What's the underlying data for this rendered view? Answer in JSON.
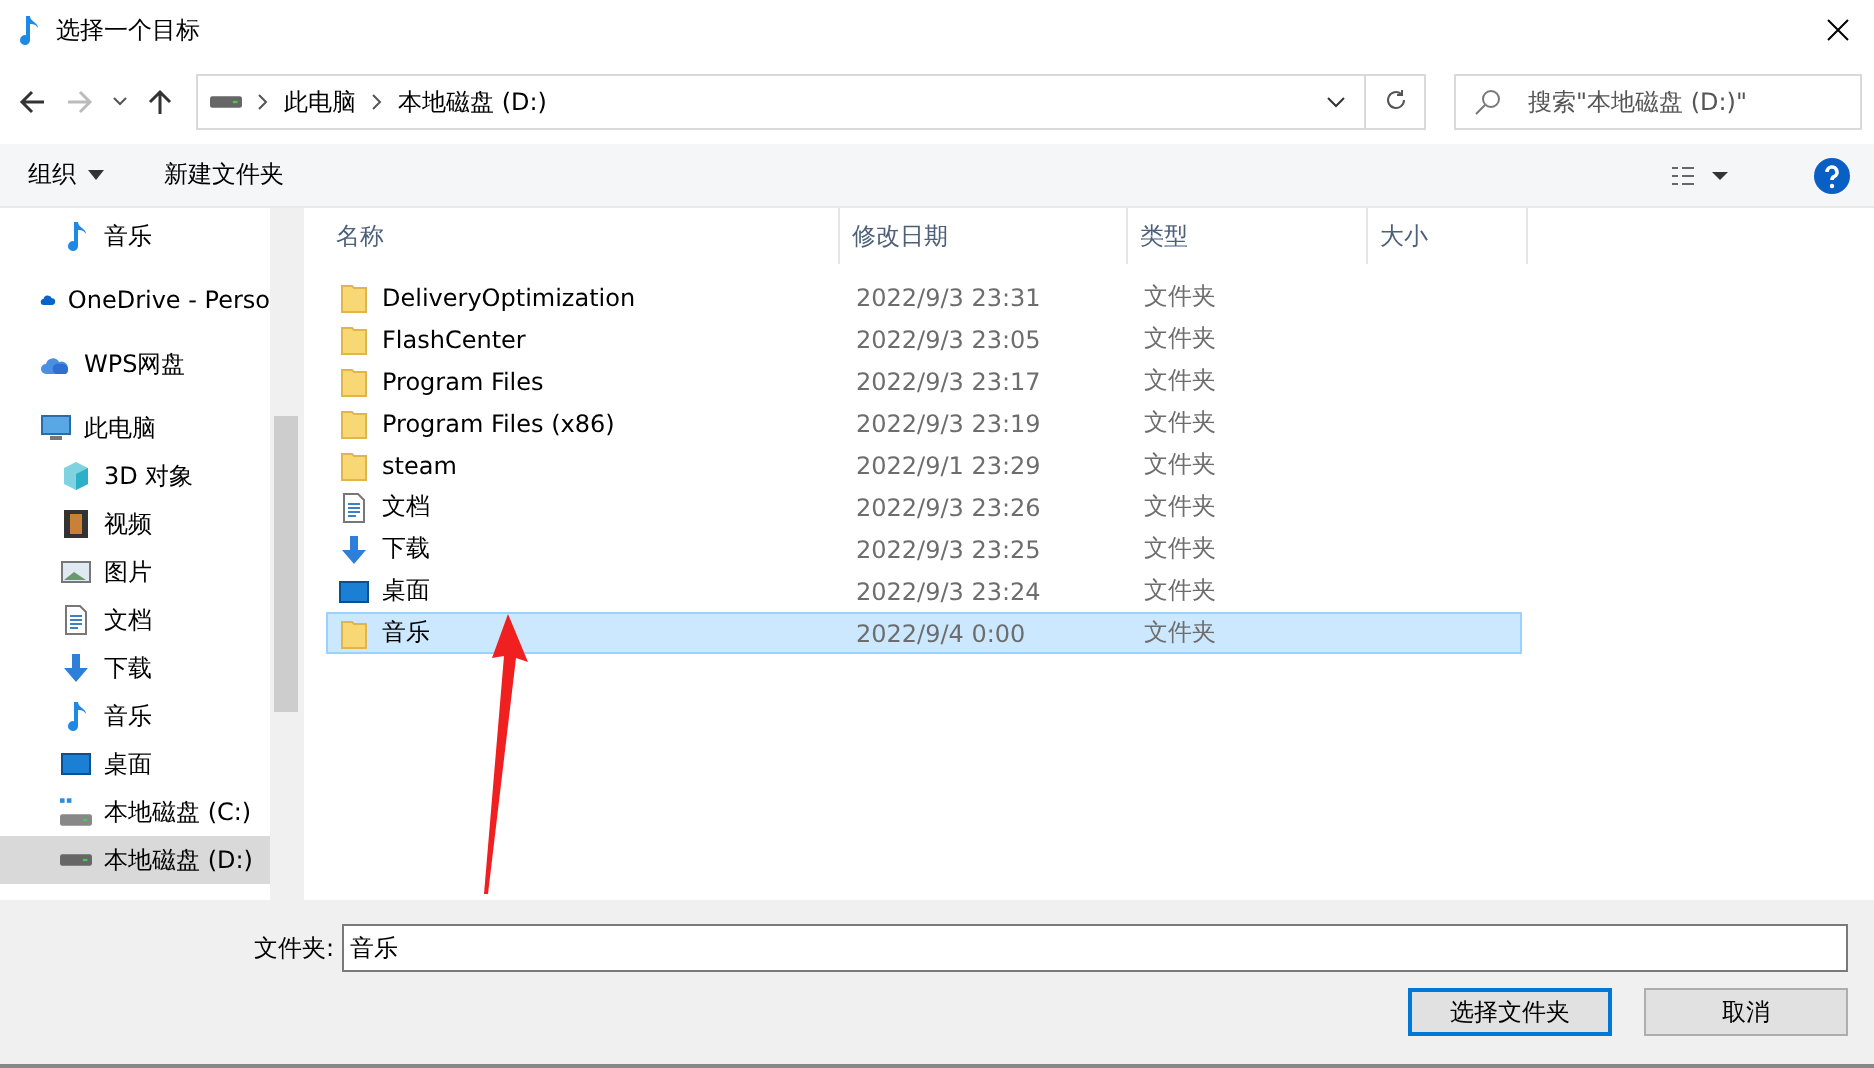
{
  "window": {
    "title": "选择一个目标"
  },
  "address": {
    "crumbs": [
      "此电脑",
      "本地磁盘 (D:)"
    ],
    "search_placeholder": "搜索\"本地磁盘 (D:)\""
  },
  "toolbar": {
    "organize": "组织",
    "new_folder": "新建文件夹"
  },
  "sidebar": {
    "quick_access_tail": [
      {
        "label": "音乐",
        "kind": "music"
      }
    ],
    "items": [
      {
        "label": "OneDrive - Perso",
        "kind": "cloud"
      },
      {
        "label": "WPS网盘",
        "kind": "cloud2"
      },
      {
        "label": "此电脑",
        "kind": "pc",
        "selected": false,
        "children": [
          {
            "label": "3D 对象",
            "kind": "cube",
            "selected": false
          },
          {
            "label": "视频",
            "kind": "video",
            "selected": false
          },
          {
            "label": "图片",
            "kind": "picture",
            "selected": false
          },
          {
            "label": "文档",
            "kind": "doc",
            "selected": false
          },
          {
            "label": "下载",
            "kind": "download",
            "selected": false
          },
          {
            "label": "音乐",
            "kind": "music",
            "selected": false
          },
          {
            "label": "桌面",
            "kind": "desktop",
            "selected": false
          },
          {
            "label": "本地磁盘 (C:)",
            "kind": "drivec",
            "selected": false
          },
          {
            "label": "本地磁盘 (D:)",
            "kind": "drive",
            "selected": true
          }
        ]
      }
    ]
  },
  "table": {
    "columns": [
      "名称",
      "修改日期",
      "类型",
      "大小"
    ],
    "rows": [
      {
        "name": "DeliveryOptimization",
        "date": "2022/9/3 23:31",
        "type": "文件夹",
        "kind": "folder",
        "selected": false
      },
      {
        "name": "FlashCenter",
        "date": "2022/9/3 23:05",
        "type": "文件夹",
        "kind": "folder",
        "selected": false
      },
      {
        "name": "Program Files",
        "date": "2022/9/3 23:17",
        "type": "文件夹",
        "kind": "folder",
        "selected": false
      },
      {
        "name": "Program Files (x86)",
        "date": "2022/9/3 23:19",
        "type": "文件夹",
        "kind": "folder",
        "selected": false
      },
      {
        "name": "steam",
        "date": "2022/9/1 23:29",
        "type": "文件夹",
        "kind": "folder",
        "selected": false
      },
      {
        "name": "文档",
        "date": "2022/9/3 23:26",
        "type": "文件夹",
        "kind": "doc",
        "selected": false
      },
      {
        "name": "下载",
        "date": "2022/9/3 23:25",
        "type": "文件夹",
        "kind": "download",
        "selected": false
      },
      {
        "name": "桌面",
        "date": "2022/9/3 23:24",
        "type": "文件夹",
        "kind": "desktop",
        "selected": false
      },
      {
        "name": "音乐",
        "date": "2022/9/4 0:00",
        "type": "文件夹",
        "kind": "folder",
        "selected": true
      }
    ]
  },
  "footer": {
    "label": "文件夹:",
    "value": "音乐",
    "ok": "选择文件夹",
    "cancel": "取消"
  }
}
